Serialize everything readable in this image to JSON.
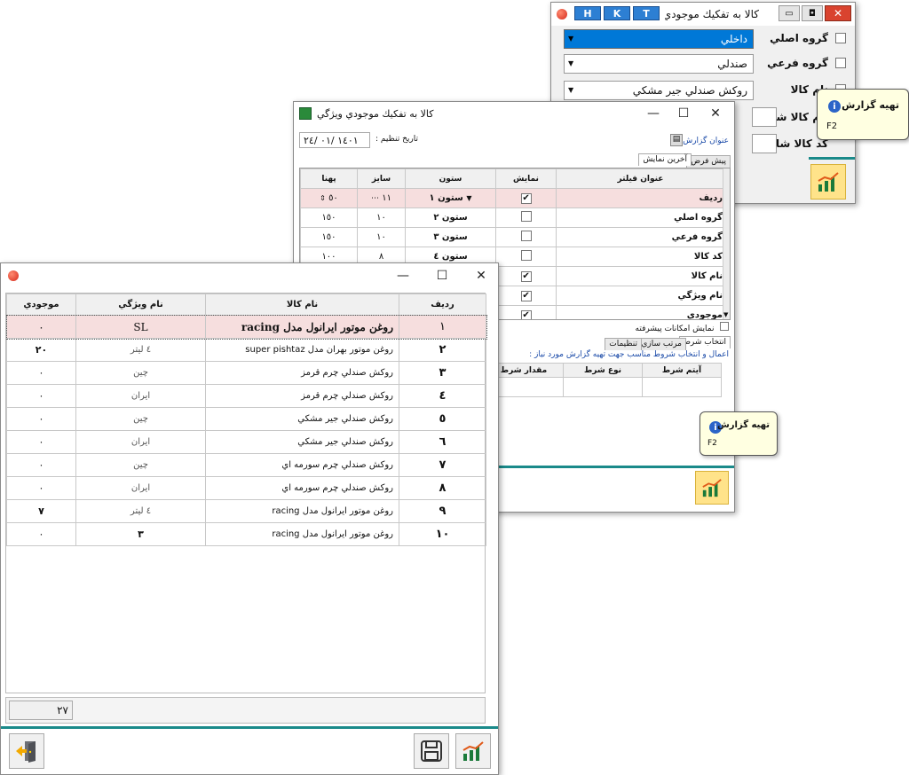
{
  "colors": {
    "accent": "#0078d7",
    "highlight_row": "#f6dede",
    "teal": "#1a8a8a",
    "tooltip_bg": "#ffffe1",
    "chart_btn": "#ffe38a"
  },
  "window1": {
    "title": "كالا به تفكيك موجودي س",
    "hkt": [
      "H",
      "K",
      "T"
    ],
    "filters": [
      {
        "label": "گروه اصلي",
        "value": "داخلي",
        "selected": true
      },
      {
        "label": "گروه فرعي",
        "value": "صندلي",
        "selected": false
      },
      {
        "label": "نام كالا",
        "value": "روكش صندلي جير مشكي",
        "selected": false
      },
      {
        "label": "نام كالا شامل",
        "value": "",
        "selected": false
      },
      {
        "label": "كد كالا شامل",
        "value": "",
        "selected": false
      }
    ],
    "tooltip": {
      "title": "تهيه گزارش",
      "key": "F2"
    }
  },
  "window2": {
    "title": "كالا به تفكيك موجودي ويژگي",
    "date_label": "تاريخ تنظيم :",
    "date_value": "١٤٠١ /٠١ /٢٤",
    "report_title_label": "عنوان گزارش :",
    "tabs": [
      "پيش فرض",
      "آخرين نمايش"
    ],
    "columns": [
      "عنوان فيلتر",
      "نمايش",
      "ستون",
      "سايز",
      "پهنا"
    ],
    "rows": [
      {
        "name": "رديف",
        "show": true,
        "col": "ستون ١",
        "size": "١١",
        "width": "٥٠"
      },
      {
        "name": "گروه اصلي",
        "show": false,
        "col": "ستون ٢",
        "size": "١٠",
        "width": "١٥٠"
      },
      {
        "name": "گروه فرعي",
        "show": false,
        "col": "ستون ٣",
        "size": "١٠",
        "width": "١٥٠"
      },
      {
        "name": "كد كالا",
        "show": false,
        "col": "ستون ٤",
        "size": "٨",
        "width": "١٠٠"
      },
      {
        "name": "نام كالا",
        "show": true,
        "col": "",
        "size": "",
        "width": ""
      },
      {
        "name": "نام ويژگي",
        "show": true,
        "col": "",
        "size": "",
        "width": ""
      },
      {
        "name": "موجودي",
        "show": true,
        "col": "",
        "size": "",
        "width": ""
      }
    ],
    "advanced_label": "نمايش امكانات پيشرفته",
    "cond_tabs": [
      "انتخاب شرط",
      "مرتب سازي",
      "تنظيمات"
    ],
    "cond_hint": "اعمال و انتخاب شروط مناسب جهت تهيه گزارش مورد نياز :",
    "cond_columns": [
      "آيتم شرط",
      "نوع شرط",
      "مقدار شرط"
    ],
    "tooltip": {
      "title": "تهيه گزارش",
      "key": "F2"
    }
  },
  "window3": {
    "columns": [
      "رديف",
      "نام كالا",
      "نام ويژگي",
      "موجودي"
    ],
    "rows": [
      {
        "idx": "١",
        "name": "روغن موتور ايرانول مدل racing",
        "attr": "SL",
        "qty": "٠"
      },
      {
        "idx": "٢",
        "name": "روغن موتور بهران مدل super pishtaz",
        "attr": "٤ ليتر",
        "qty": "٢٠"
      },
      {
        "idx": "٣",
        "name": "روكش صندلي چرم قرمز",
        "attr": "چين",
        "qty": "٠"
      },
      {
        "idx": "٤",
        "name": "روكش صندلي چرم قرمز",
        "attr": "ايران",
        "qty": "٠"
      },
      {
        "idx": "٥",
        "name": "روكش صندلي جير مشكي",
        "attr": "چين",
        "qty": "٠"
      },
      {
        "idx": "٦",
        "name": "روكش صندلي جير مشكي",
        "attr": "ايران",
        "qty": "٠"
      },
      {
        "idx": "٧",
        "name": "روكش صندلي چرم سورمه اي",
        "attr": "چين",
        "qty": "٠"
      },
      {
        "idx": "٨",
        "name": "روكش صندلي چرم سورمه اي",
        "attr": "ايران",
        "qty": "٠"
      },
      {
        "idx": "٩",
        "name": "روغن موتور ايرانول مدل racing",
        "attr": "٤ ليتر",
        "qty": "٧"
      },
      {
        "idx": "١٠",
        "name": "روغن موتور ايرانول مدل racing",
        "attr": "٣",
        "qty": "٠"
      }
    ],
    "total": "٢٧"
  }
}
